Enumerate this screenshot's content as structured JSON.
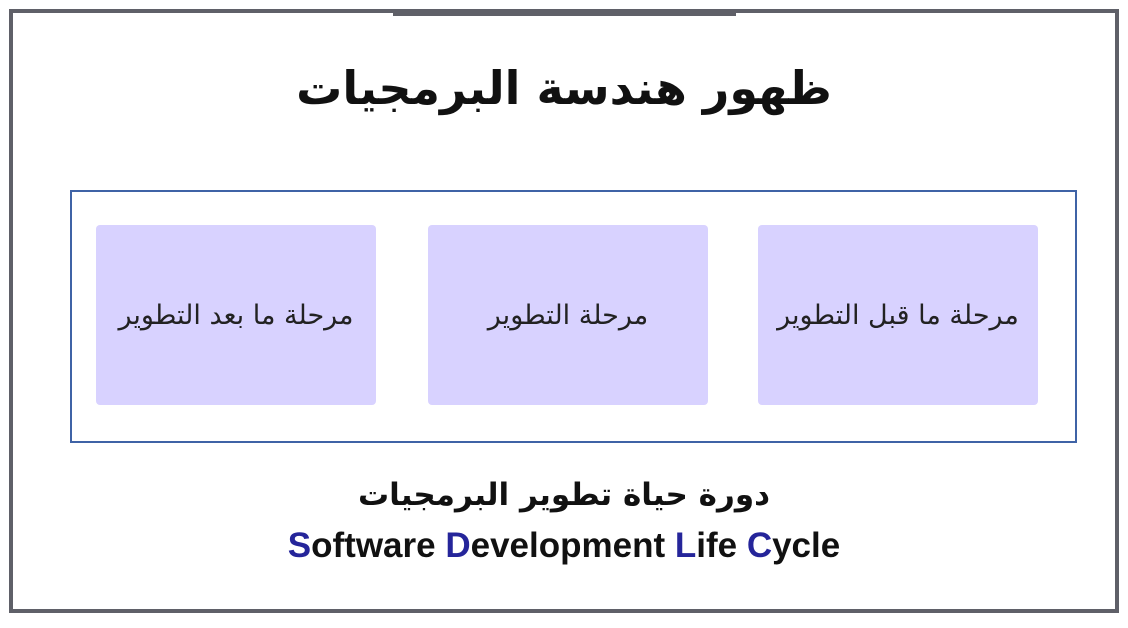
{
  "slide": {
    "title": "ظهور هندسة البرمجيات",
    "stages": [
      {
        "label": "مرحلة ما قبل التطوير"
      },
      {
        "label": "مرحلة التطوير"
      },
      {
        "label": "مرحلة ما بعد التطوير"
      }
    ],
    "caption_ar": "دورة حياة تطوير البرمجيات",
    "caption_en": {
      "parts": [
        {
          "initial": "S",
          "rest": "oftware "
        },
        {
          "initial": "D",
          "rest": "evelopment "
        },
        {
          "initial": "L",
          "rest": "ife "
        },
        {
          "initial": "C",
          "rest": "ycle"
        }
      ]
    }
  },
  "colors": {
    "frame": "#5f6068",
    "stage_box_border": "#3f63a6",
    "stage_fill": "#d8d2ff",
    "initial_letters": "#25259a"
  }
}
